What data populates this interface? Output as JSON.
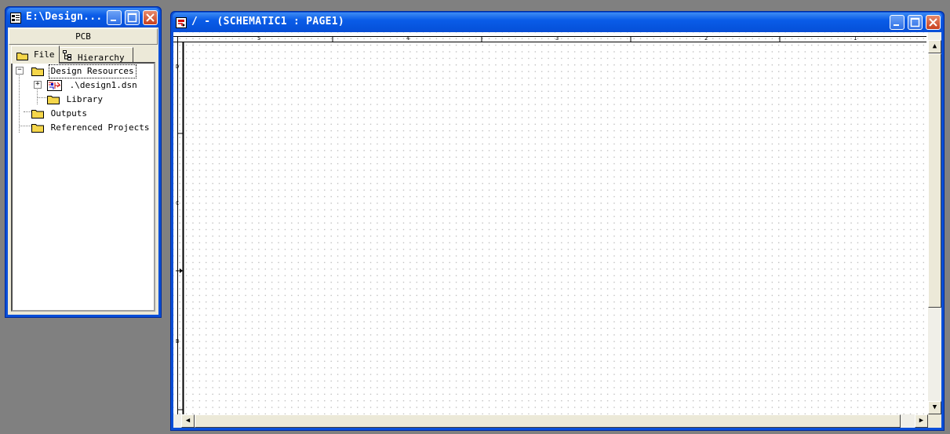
{
  "project_window": {
    "title": "E:\\Design...",
    "toolbar_label": "PCB",
    "tabs": [
      {
        "label": "File",
        "active": true
      },
      {
        "label": "Hierarchy",
        "active": false
      }
    ],
    "tree": {
      "root": "Design Resources",
      "design_file": ".\\design1.dsn",
      "library": "Library",
      "outputs": "Outputs",
      "referenced": "Referenced Projects"
    }
  },
  "schematic_window": {
    "title": "/ - (SCHEMATIC1 : PAGE1)",
    "ruler_columns": [
      "5",
      "4",
      "3",
      "2",
      "1"
    ],
    "ruler_rows": [
      "D",
      "C",
      "B"
    ]
  },
  "colors": {
    "desktop": "#808080",
    "titlebar": "#0a5ce8",
    "folder": "#f5d64a"
  },
  "icons": {
    "project": "project-window-icon",
    "schematic": "schematic-window-icon",
    "folder": "folder-icon",
    "design": "design-file-icon"
  }
}
